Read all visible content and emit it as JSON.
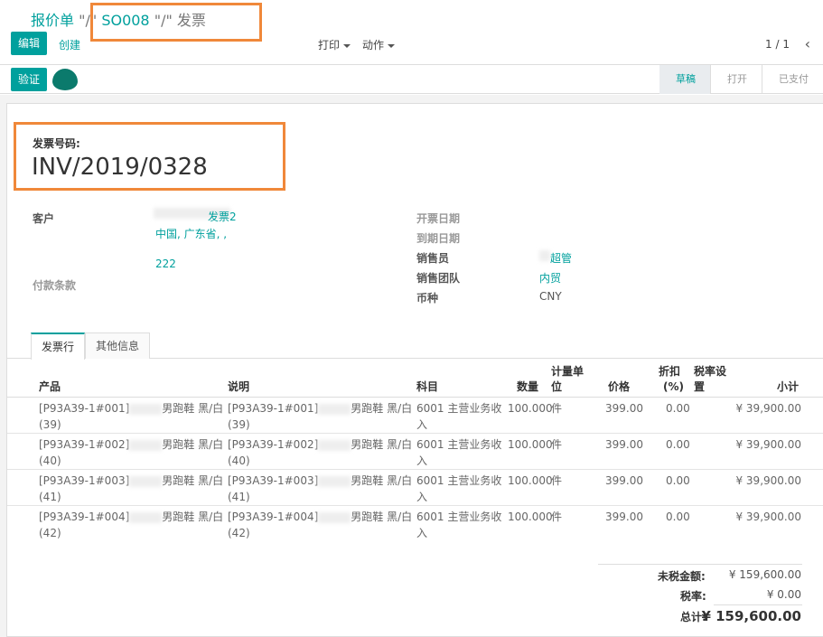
{
  "breadcrumb": {
    "root": "报价单",
    "sep1": "\"/\"",
    "order": "SO008",
    "sep2": "\"/\"",
    "current": "发票"
  },
  "toolbar": {
    "edit_label": "编辑",
    "create_label": "创建",
    "print_label": "打印",
    "action_label": "动作",
    "pager": "1 / 1",
    "prev_icon": "chevron-left-icon"
  },
  "statusbar": {
    "validate_label": "验证",
    "steps": [
      {
        "label": "草稿",
        "active": true
      },
      {
        "label": "打开",
        "active": false
      },
      {
        "label": "已支付",
        "active": false
      }
    ]
  },
  "invoice": {
    "number_label": "发票号码:",
    "number": "INV/2019/0328"
  },
  "fields": {
    "customer_label": "客户",
    "customer_name": "发票2",
    "customer_address": "中国, 广东省, ,",
    "customer_zip": "222",
    "payment_terms_label": "付款条款",
    "invoice_date_label": "开票日期",
    "due_date_label": "到期日期",
    "salesperson_label": "销售员",
    "salesperson_value": "超管",
    "sales_team_label": "销售团队",
    "sales_team_value": "内贸",
    "currency_label": "币种",
    "currency_value": "CNY"
  },
  "tabs": [
    {
      "label": "发票行",
      "active": true
    },
    {
      "label": "其他信息",
      "active": false
    }
  ],
  "table": {
    "headers": {
      "product": "产品",
      "description": "说明",
      "account": "科目",
      "qty": "数量",
      "uom_1": "计量单",
      "uom_2": "位",
      "price": "价格",
      "discount_1": "折扣",
      "discount_2": "(%)",
      "tax_1": "税率设",
      "tax_2": "置",
      "subtotal": "小计"
    },
    "rows": [
      {
        "product_a": "[P93A39-1#001]",
        "product_b": "男跑鞋 黑/白",
        "product_c": "(39)",
        "desc_a": "[P93A39-1#001]",
        "desc_b": "男跑鞋 黑/白",
        "desc_c": "(39)",
        "account_a": "6001 主营业务收",
        "account_b": "入",
        "qty": "100.000",
        "uom": "件",
        "price": "399.00",
        "discount": "0.00",
        "subtotal": "¥ 39,900.00"
      },
      {
        "product_a": "[P93A39-1#002]",
        "product_b": "男跑鞋 黑/白",
        "product_c": "(40)",
        "desc_a": "[P93A39-1#002]",
        "desc_b": "男跑鞋 黑/白",
        "desc_c": "(40)",
        "account_a": "6001 主营业务收",
        "account_b": "入",
        "qty": "100.000",
        "uom": "件",
        "price": "399.00",
        "discount": "0.00",
        "subtotal": "¥ 39,900.00"
      },
      {
        "product_a": "[P93A39-1#003]",
        "product_b": "男跑鞋 黑/白",
        "product_c": "(41)",
        "desc_a": "[P93A39-1#003]",
        "desc_b": "男跑鞋 黑/白",
        "desc_c": "(41)",
        "account_a": "6001 主营业务收",
        "account_b": "入",
        "qty": "100.000",
        "uom": "件",
        "price": "399.00",
        "discount": "0.00",
        "subtotal": "¥ 39,900.00"
      },
      {
        "product_a": "[P93A39-1#004]",
        "product_b": "男跑鞋 黑/白",
        "product_c": "(42)",
        "desc_a": "[P93A39-1#004]",
        "desc_b": "男跑鞋 黑/白",
        "desc_c": "(42)",
        "account_a": "6001 主营业务收",
        "account_b": "入",
        "qty": "100.000",
        "uom": "件",
        "price": "399.00",
        "discount": "0.00",
        "subtotal": "¥ 39,900.00"
      }
    ]
  },
  "totals": {
    "untaxed_label": "未税金额:",
    "untaxed_value": "¥ 159,600.00",
    "tax_label": "税率:",
    "tax_value": "¥ 0.00",
    "total_label": "总计:",
    "total_value": "¥ 159,600.00"
  },
  "colors": {
    "accent": "#00A09D",
    "highlight": "#f0883a"
  }
}
